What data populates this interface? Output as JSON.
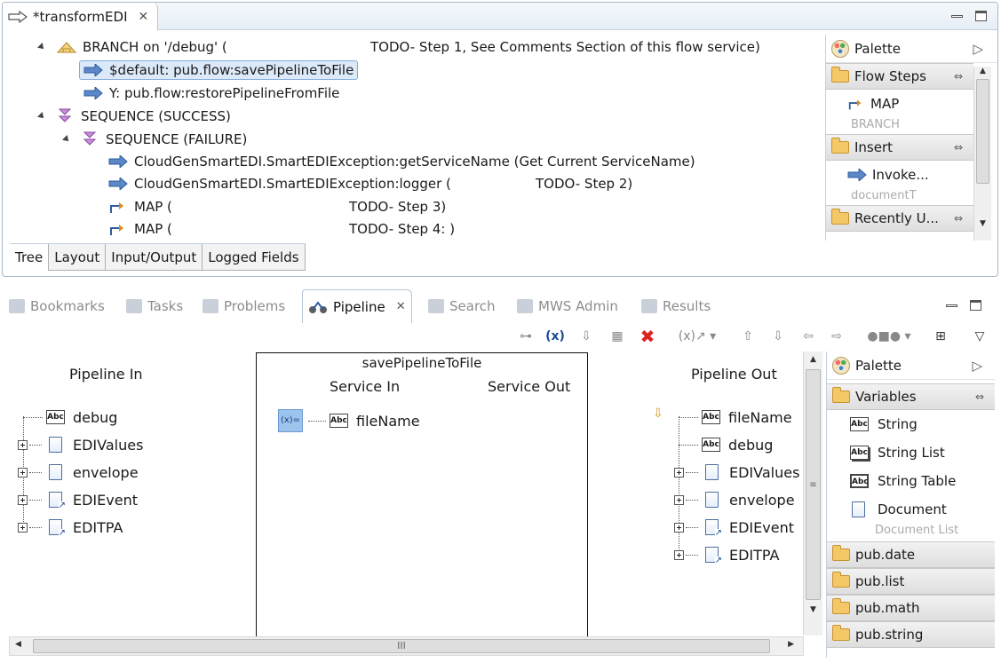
{
  "editor": {
    "tab_title": "*transformEDI",
    "tree": [
      {
        "kind": "branch",
        "label": "BRANCH on '/debug' (",
        "comment": "TODO- Step 1, See Comments Section of this flow service)"
      },
      {
        "kind": "invoke",
        "label": "$default: pub.flow:savePipelineToFile",
        "selected": true
      },
      {
        "kind": "invoke",
        "label": "Y: pub.flow:restorePipelineFromFile"
      },
      {
        "kind": "sequence",
        "label": "SEQUENCE (SUCCESS)"
      },
      {
        "kind": "sequence",
        "label": "SEQUENCE (FAILURE)"
      },
      {
        "kind": "invoke",
        "label": "CloudGenSmartEDI.SmartEDIException:getServiceName (Get Current ServiceName)"
      },
      {
        "kind": "invoke",
        "label": "CloudGenSmartEDI.SmartEDIException:logger (",
        "comment": "TODO- Step 2)"
      },
      {
        "kind": "map",
        "label": "MAP (",
        "comment": "TODO- Step 3)"
      },
      {
        "kind": "map",
        "label": "MAP (",
        "comment": "TODO- Step 4: )"
      }
    ],
    "bottom_tabs": [
      "Tree",
      "Layout",
      "Input/Output",
      "Logged Fields"
    ],
    "palette": {
      "title": "Palette",
      "drawers": [
        {
          "label": "Flow Steps",
          "items": [
            "MAP",
            "BRANCH"
          ]
        },
        {
          "label": "Insert",
          "items": [
            "Invoke...",
            "documentT"
          ]
        },
        {
          "label": "Recently U...",
          "items": []
        }
      ]
    }
  },
  "views": {
    "tabs": [
      "Bookmarks",
      "Tasks",
      "Problems",
      "Pipeline",
      "Search",
      "MWS Admin",
      "Results"
    ],
    "active_tab": "Pipeline",
    "pipeline": {
      "pipeline_in_title": "Pipeline In",
      "pipeline_out_title": "Pipeline Out",
      "service_title": "savePipelineToFile",
      "service_in_title": "Service In",
      "service_out_title": "Service Out",
      "pipeline_in": [
        {
          "type": "string",
          "name": "debug"
        },
        {
          "type": "document",
          "name": "EDIValues"
        },
        {
          "type": "document",
          "name": "envelope"
        },
        {
          "type": "docref",
          "name": "EDIEvent"
        },
        {
          "type": "docref",
          "name": "EDITPA"
        }
      ],
      "service_in": [
        {
          "type": "string",
          "name": "fileName"
        }
      ],
      "pipeline_out": [
        {
          "type": "string",
          "name": "fileName"
        },
        {
          "type": "string",
          "name": "debug"
        },
        {
          "type": "document",
          "name": "EDIValues"
        },
        {
          "type": "document",
          "name": "envelope"
        },
        {
          "type": "docref",
          "name": "EDIEvent"
        },
        {
          "type": "docref",
          "name": "EDITPA"
        }
      ],
      "hscroll_grip": "III"
    },
    "palette": {
      "title": "Palette",
      "drawer": "Variables",
      "items": [
        "String",
        "String List",
        "String Table",
        "Document",
        "Document List"
      ],
      "collapsed_drawers": [
        "pub.date",
        "pub.list",
        "pub.math",
        "pub.string"
      ]
    }
  },
  "colors": {
    "accent": "#3d6fb8",
    "selection": "#dce9f9",
    "border": "#a7b9cc"
  }
}
